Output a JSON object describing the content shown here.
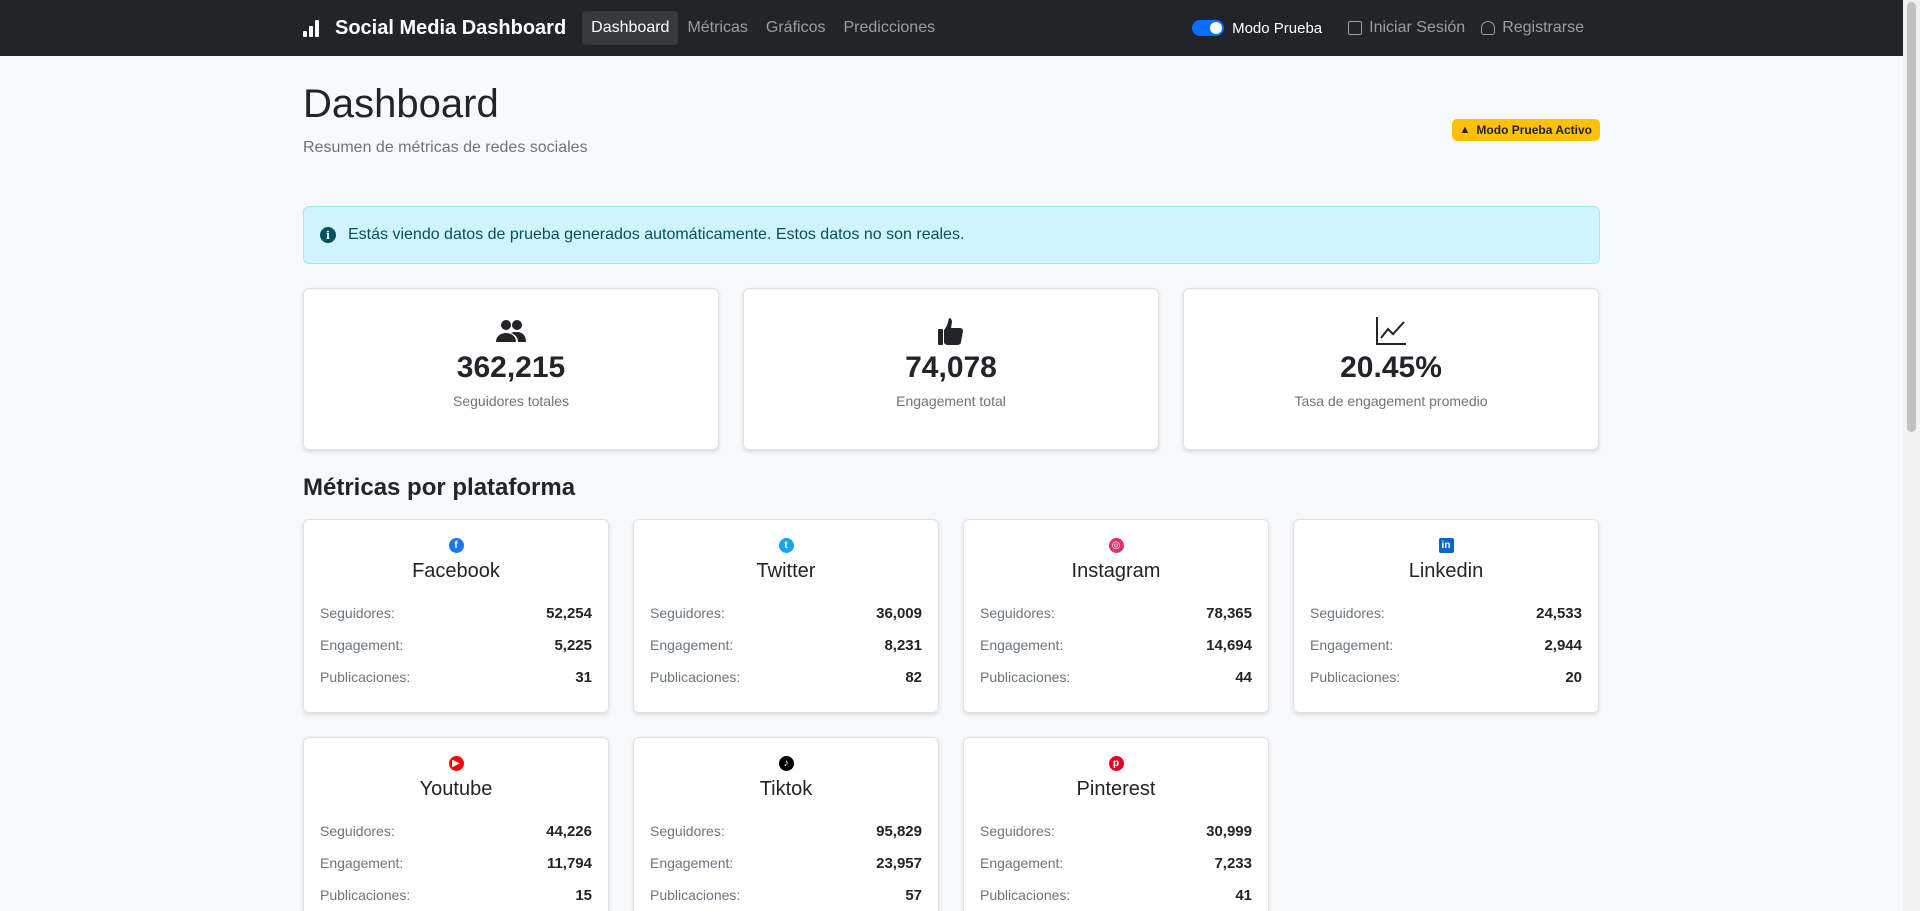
{
  "navbar": {
    "brand": "Social Media Dashboard",
    "links": [
      "Dashboard",
      "Métricas",
      "Gráficos",
      "Predicciones"
    ],
    "toggle_label": "Modo Prueba",
    "login": "Iniciar Sesión",
    "register": "Registrarse"
  },
  "header": {
    "title": "Dashboard",
    "subtitle": "Resumen de métricas de redes sociales",
    "badge": "Modo Prueba Activo"
  },
  "alert": "Estás viendo datos de prueba generados automáticamente. Estos datos no son reales.",
  "stats": [
    {
      "value": "362,215",
      "label": "Seguidores totales",
      "icon": "users-icon"
    },
    {
      "value": "74,078",
      "label": "Engagement total",
      "icon": "thumbs-up-icon"
    },
    {
      "value": "20.45%",
      "label": "Tasa de engagement promedio",
      "icon": "chart-line-icon"
    }
  ],
  "section_title": "Métricas por plataforma",
  "labels": {
    "followers": "Seguidores:",
    "engagement": "Engagement:",
    "posts": "Publicaciones:"
  },
  "platforms": [
    {
      "name": "Facebook",
      "followers": "52,254",
      "engagement": "5,225",
      "posts": "31",
      "color": "#1877f2",
      "glyph": "f"
    },
    {
      "name": "Twitter",
      "followers": "36,009",
      "engagement": "8,231",
      "posts": "82",
      "color": "#1da1f2",
      "glyph": "t"
    },
    {
      "name": "Instagram",
      "followers": "78,365",
      "engagement": "14,694",
      "posts": "44",
      "color": "#e1306c",
      "glyph": "◎"
    },
    {
      "name": "Linkedin",
      "followers": "24,533",
      "engagement": "2,944",
      "posts": "20",
      "color": "#0a66c2",
      "glyph": "in"
    },
    {
      "name": "Youtube",
      "followers": "44,226",
      "engagement": "11,794",
      "posts": "15",
      "color": "#ff0000",
      "glyph": "▶"
    },
    {
      "name": "Tiktok",
      "followers": "95,829",
      "engagement": "23,957",
      "posts": "57",
      "color": "#000000",
      "glyph": "♪"
    },
    {
      "name": "Pinterest",
      "followers": "30,999",
      "engagement": "7,233",
      "posts": "41",
      "color": "#e60023",
      "glyph": "p"
    }
  ]
}
